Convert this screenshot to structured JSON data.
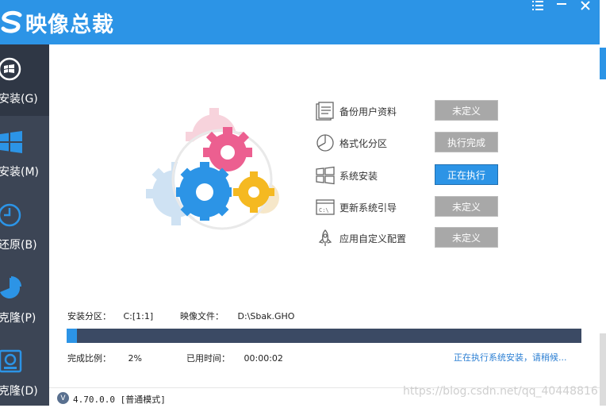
{
  "app": {
    "title": "映像总裁",
    "brand_color": "#2c94e6"
  },
  "window_controls": {
    "menu_icon": "menu-lines-icon",
    "minimize_icon": "minimize-icon",
    "close_icon": "close-icon"
  },
  "sidebar": {
    "items": [
      {
        "label": "安装(G)",
        "icon": "gear-disc-icon"
      },
      {
        "label": "安装(M)",
        "icon": "windows-logo-icon"
      },
      {
        "label": "还原(B)",
        "icon": "clock-icon"
      },
      {
        "label": "克隆(P)",
        "icon": "pie-chart-icon"
      },
      {
        "label": "克隆(D)",
        "icon": "disk-icon"
      }
    ]
  },
  "steps": [
    {
      "label": "备份用户资料",
      "status": "未定义",
      "icon": "document-icon"
    },
    {
      "label": "格式化分区",
      "status": "执行完成",
      "icon": "pie-chart-icon"
    },
    {
      "label": "系统安装",
      "status": "正在执行",
      "icon": "windows-logo-icon"
    },
    {
      "label": "更新系统引导",
      "status": "未定义",
      "icon": "terminal-icon"
    },
    {
      "label": "应用自定义配置",
      "status": "未定义",
      "icon": "rocket-icon"
    }
  ],
  "info": {
    "partition_label": "安装分区：",
    "partition_value": "C:[1:1]",
    "image_label": "映像文件：",
    "image_value": "D:\\Sbak.GHO",
    "ratio_label": "完成比例：",
    "ratio_value": "2%",
    "elapsed_label": "已用时间：",
    "elapsed_value": "00:00:02",
    "status_message": "正在执行系统安装，请稍候..."
  },
  "progress": {
    "fraction": 0.02
  },
  "statusbar": {
    "badge": "V",
    "version": "4.70.0.0 [普通模式]",
    "watermark": "https://blog.csdn.net/qq_40448816"
  }
}
